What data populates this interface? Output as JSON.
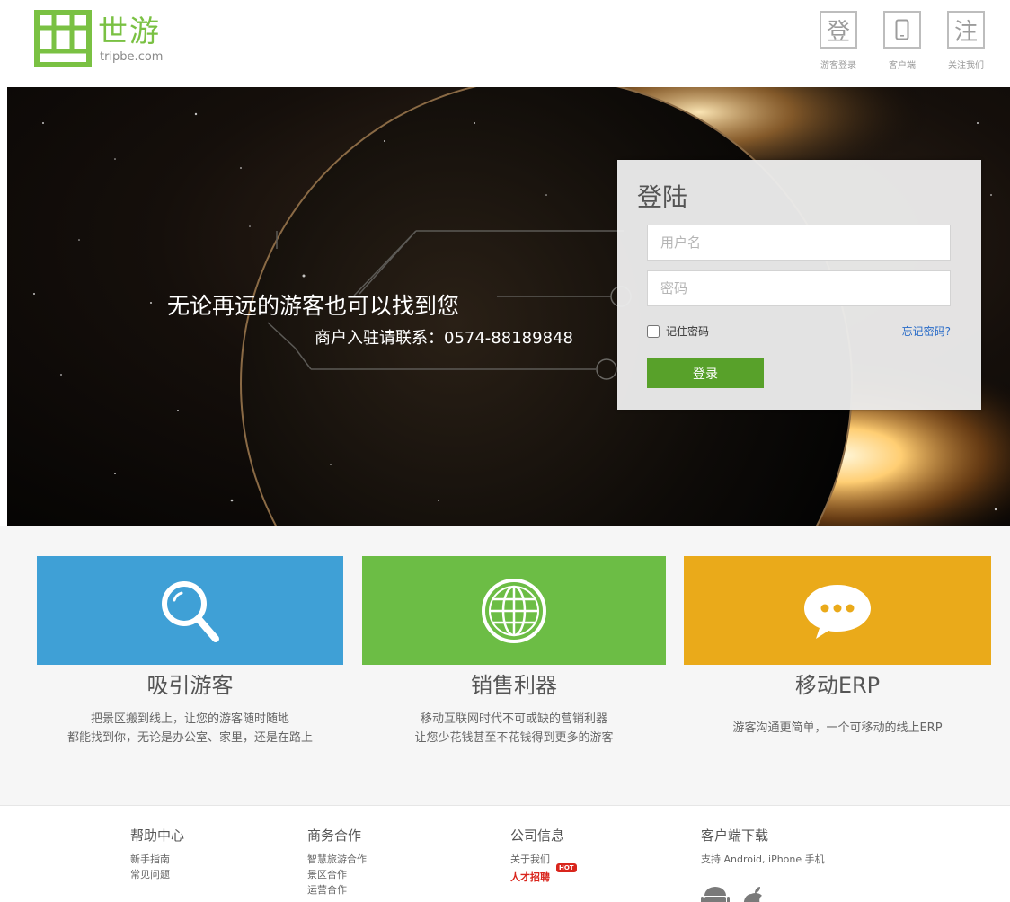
{
  "header": {
    "logo_name": "世游",
    "logo_domain": "tripbe.com",
    "actions": [
      {
        "glyph": "登",
        "label": "游客登录"
      },
      {
        "glyph": "",
        "label": "客户端",
        "icon": "phone-icon"
      },
      {
        "glyph": "注",
        "label": "关注我们"
      }
    ]
  },
  "hero": {
    "slogan": "无论再远的游客也可以找到您",
    "contact": "商户入驻请联系：0574-88189848"
  },
  "login": {
    "title": "登陆",
    "username_placeholder": "用户名",
    "password_placeholder": "密码",
    "remember_label": "记住密码",
    "forgot_label": "忘记密码?",
    "submit_label": "登录"
  },
  "features": [
    {
      "title": "吸引游客",
      "icon": "search-icon",
      "color": "#3fa0d6",
      "lines": [
        "把景区搬到线上，让您的游客随时随地",
        "都能找到你，无论是办公室、家里，还是在路上"
      ]
    },
    {
      "title": "销售利器",
      "icon": "globe-icon",
      "color": "#6cbd45",
      "lines": [
        "移动互联网时代不可或缺的营销利器",
        "让您少花钱甚至不花钱得到更多的游客"
      ]
    },
    {
      "title": "移动ERP",
      "icon": "chat-bubble-icon",
      "color": "#eaaa1a",
      "lines": [
        "游客沟通更简单，一个可移动的线上ERP"
      ]
    }
  ],
  "footer": {
    "help": {
      "title": "帮助中心",
      "links": [
        "新手指南",
        "常见问题"
      ]
    },
    "business": {
      "title": "商务合作",
      "links": [
        "智慧旅游合作",
        "景区合作",
        "运营合作"
      ]
    },
    "company": {
      "title": "公司信息",
      "links": [
        "关于我们",
        "人才招聘"
      ],
      "hot_badge": "HOT"
    },
    "download": {
      "title": "客户端下载",
      "text": "支持 Android, iPhone 手机"
    }
  },
  "colors": {
    "brand_green": "#7ac143",
    "login_button": "#58a12a",
    "link_blue": "#2a6cc8",
    "hot_red": "#d9251c"
  }
}
